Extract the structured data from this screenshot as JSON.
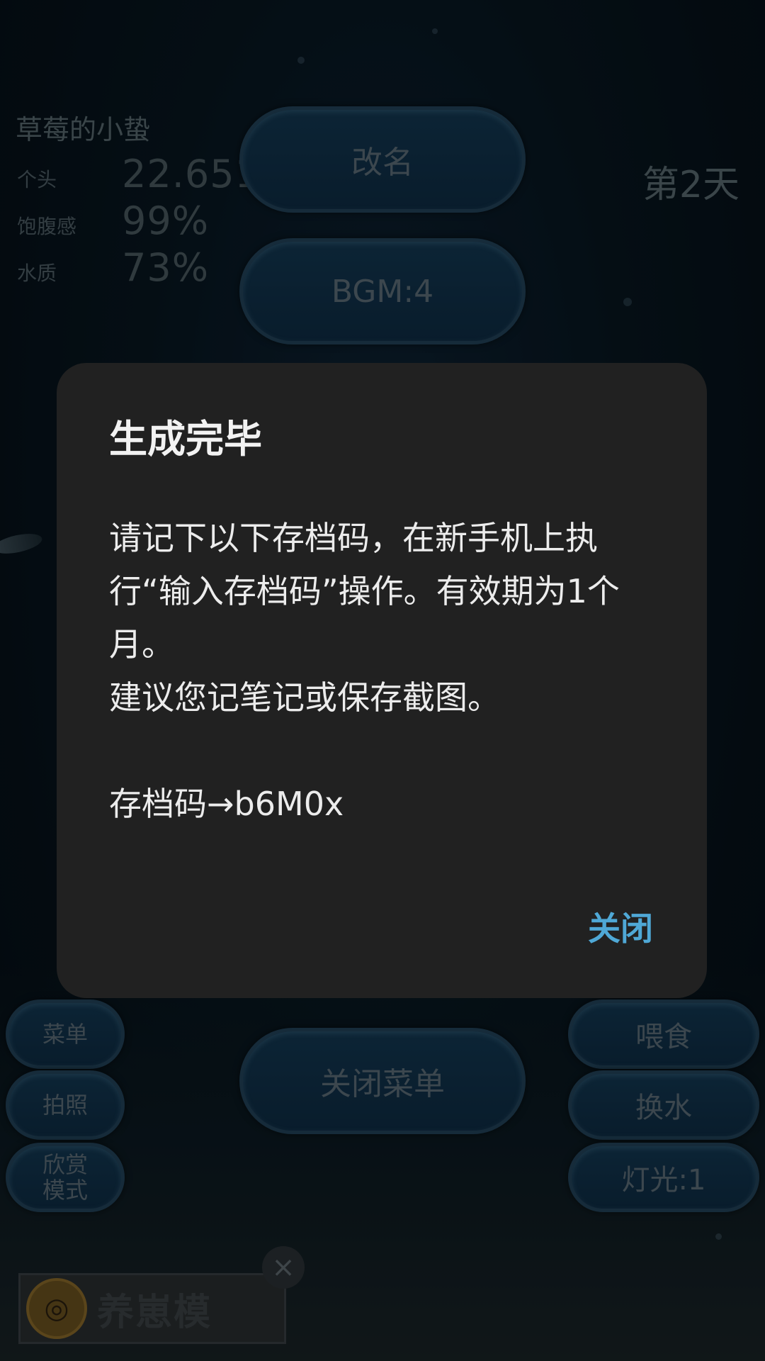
{
  "game": {
    "pet_name": "草莓的小蛰",
    "stats": [
      {
        "label": "个头",
        "value": "22.651339mm"
      },
      {
        "label": "饱腹感",
        "value": "99%"
      },
      {
        "label": "水质",
        "value": "73%"
      }
    ],
    "day": "第2天",
    "menu_buttons": {
      "rename": "改名",
      "bgm": "BGM:4",
      "close_menu": "关闭菜单"
    },
    "left_buttons": {
      "menu": "菜单",
      "photo": "拍照",
      "view_mode_line1": "欣赏",
      "view_mode_line2": "模式"
    },
    "right_buttons": {
      "feed": "喂食",
      "change_water": "换水",
      "light": "灯光:1"
    }
  },
  "ad": {
    "text": "养崽模",
    "close_icon": "close-icon"
  },
  "dialog": {
    "title": "生成完毕",
    "line1": "请记下以下存档码，在新手机上执",
    "line2": "行“输入存档码”操作。有效期为1个",
    "line3": "月。",
    "line4": "建议您记笔记或保存截图。",
    "code_line": "存档码→b6M0x",
    "close_label": "关闭"
  },
  "colors": {
    "dialog_bg": "#212121",
    "accent": "#4fa8d6"
  }
}
